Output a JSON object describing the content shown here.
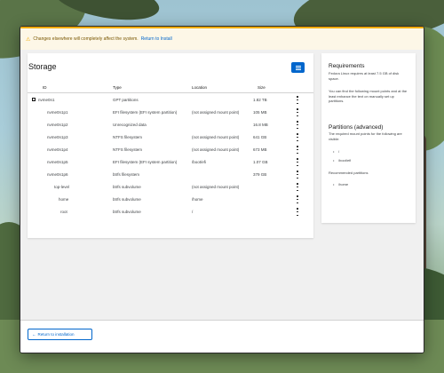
{
  "alert": {
    "text": "Changes elsewhere will completely affect the system.",
    "link": "Return to Install"
  },
  "storage": {
    "title": "Storage",
    "columns": [
      "ID",
      "Type",
      "Location",
      "Size"
    ],
    "rows": [
      {
        "id": "nvme0n1",
        "type": "GPT partitions",
        "location": "",
        "size": "1.82 TB"
      },
      {
        "id": "nvme0n1p1",
        "type": "EFI filesystem (EFI system partition)",
        "location": "(not assigned mount point)",
        "size": "105 MB"
      },
      {
        "id": "nvme0n1p2",
        "type": "Unrecognized data",
        "location": "",
        "size": "16.8 MB"
      },
      {
        "id": "nvme0n1p3",
        "type": "NTFS filesystem",
        "location": "(not assigned mount point)",
        "size": "641 GB"
      },
      {
        "id": "nvme0n1p4",
        "type": "NTFS filesystem",
        "location": "(not assigned mount point)",
        "size": "673 MB"
      },
      {
        "id": "nvme0n1p5",
        "type": "EFI filesystem (EFI system partition)",
        "location": "/boot/efi",
        "size": "1.07 GB"
      },
      {
        "id": "nvme0n1p6",
        "type": "btrfs filesystem",
        "location": "",
        "size": "379 GB"
      },
      {
        "id": "top-level",
        "type": "btrfs subvolume",
        "location": "(not assigned mount point)",
        "size": ""
      },
      {
        "id": "home",
        "type": "btrfs subvolume",
        "location": "/home",
        "size": ""
      },
      {
        "id": "root",
        "type": "btrfs subvolume",
        "location": "/",
        "size": ""
      }
    ]
  },
  "requirements": {
    "title": "Requirements",
    "p1": "Fedora Linux requires at least 7.5 GB of disk space.",
    "p2": "You can find the following mount points and at the least enhance the text on manually set up partitions.",
    "partitions_title": "Partitions (advanced)",
    "p3": "The required mount points for the following are visible:",
    "required": [
      "/",
      "/boot/efi"
    ],
    "recommended_label": "Recommended partitions",
    "recommended": [
      "/home"
    ]
  },
  "footer": {
    "return_label": "Return to installation"
  },
  "colors": {
    "accent": "#0066cc",
    "warning": "#f0ab00"
  }
}
